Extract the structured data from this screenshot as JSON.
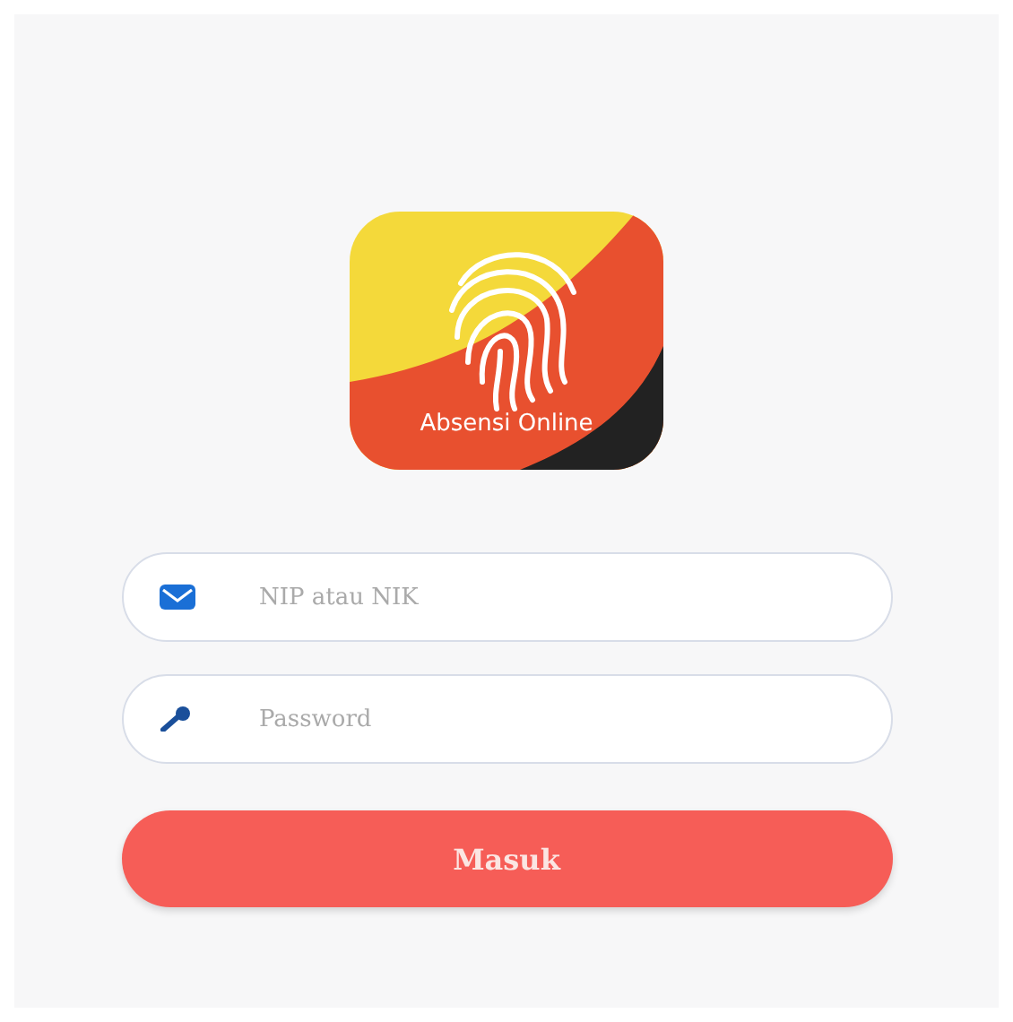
{
  "logo": {
    "caption": "Absensi Online"
  },
  "fields": [
    {
      "kind": "email",
      "placeholder": "NIP atau NIK"
    },
    {
      "kind": "key",
      "placeholder": "Password"
    }
  ],
  "button": {
    "label": "Masuk"
  }
}
